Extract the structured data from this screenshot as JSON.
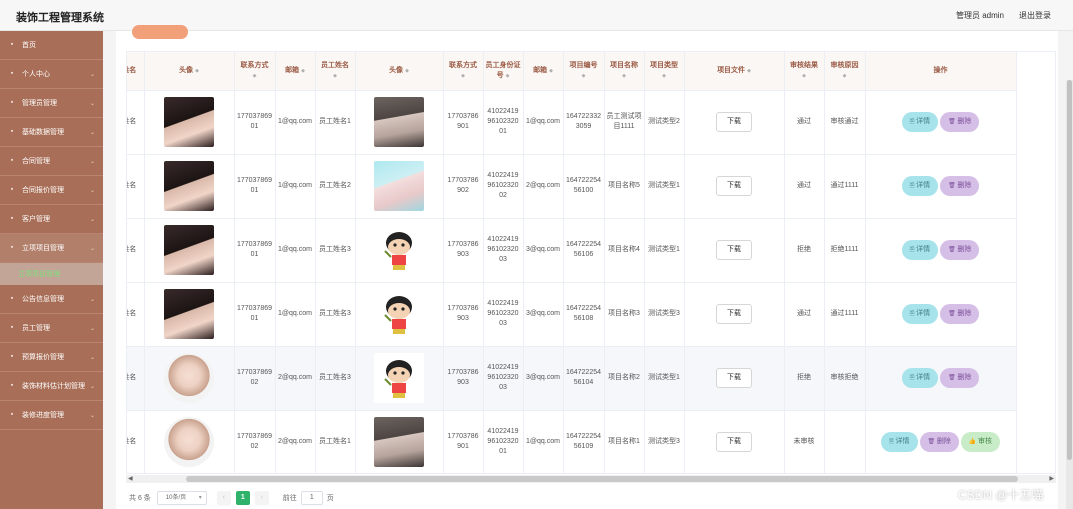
{
  "header": {
    "title": "装饰工程管理系统",
    "user": "管理员 admin",
    "logout": "退出登录"
  },
  "sidebar": {
    "items": [
      {
        "label": "首页",
        "icon": "home-icon"
      },
      {
        "label": "个人中心",
        "icon": "user-icon"
      },
      {
        "label": "管理员管理",
        "icon": "admin-icon"
      },
      {
        "label": "基础数据管理",
        "icon": "data-icon"
      },
      {
        "label": "合同管理",
        "icon": "contract-icon"
      },
      {
        "label": "合同报价管理",
        "icon": "quote-icon"
      },
      {
        "label": "客户管理",
        "icon": "customer-icon"
      },
      {
        "label": "立项项目管理",
        "icon": "project-icon"
      },
      {
        "label": "立项项目管理",
        "icon": "",
        "sub": true
      },
      {
        "label": "公告信息管理",
        "icon": "notice-icon"
      },
      {
        "label": "员工管理",
        "icon": "staff-icon"
      },
      {
        "label": "预算报价管理",
        "icon": "budget-icon"
      },
      {
        "label": "装饰材料估计划管理",
        "icon": "material-icon"
      },
      {
        "label": "装修进度管理",
        "icon": "progress-icon"
      }
    ]
  },
  "table": {
    "headers": {
      "name1": "姓名",
      "avatar1": "头像",
      "phone1": "联系方式",
      "email1": "邮箱",
      "emp_name": "员工姓名",
      "avatar2": "头像",
      "phone2": "联系方式",
      "id_no": "员工身份证号",
      "email2": "邮箱",
      "proj_no": "项目编号",
      "proj_name": "项目名称",
      "proj_type": "项目类型",
      "proj_file": "项目文件",
      "audit_result": "审核结果",
      "audit_reason": "审核原因",
      "ops": "操作"
    },
    "rows": [
      {
        "name1": "姓名",
        "avatar1": "dark-hair-photo",
        "phone1": "17703786901",
        "email1": "1@qq.com",
        "emp_name": "员工姓名1",
        "avatar2": "gray-photo",
        "phone2": "17703786901",
        "id_no": "410224199610232001",
        "email2": "1@qq.com",
        "proj_no": "1647223323059",
        "proj_name": "员工测试项目1111",
        "proj_type": "测试类型2",
        "file_btn": "下载",
        "audit_result": "通过",
        "audit_reason": "审核通过",
        "ops": [
          "详情",
          "删除"
        ]
      },
      {
        "name1": "姓名",
        "avatar1": "dark-hair-photo",
        "phone1": "17703786901",
        "email1": "1@qq.com",
        "emp_name": "员工姓名2",
        "avatar2": "cyan-photo",
        "phone2": "17703786902",
        "id_no": "410224199610232002",
        "email2": "2@qq.com",
        "proj_no": "16472225456100",
        "proj_name": "项目名称5",
        "proj_type": "测试类型1",
        "file_btn": "下载",
        "audit_result": "通过",
        "audit_reason": "通过1111",
        "ops": [
          "详情",
          "删除"
        ]
      },
      {
        "name1": "姓名",
        "avatar1": "dark-hair-photo",
        "phone1": "17703786901",
        "email1": "1@qq.com",
        "emp_name": "员工姓名3",
        "avatar2": "cartoon",
        "phone2": "17703786903",
        "id_no": "410224199610232003",
        "email2": "3@qq.com",
        "proj_no": "16472225456106",
        "proj_name": "项目名称4",
        "proj_type": "测试类型1",
        "file_btn": "下载",
        "audit_result": "拒绝",
        "audit_reason": "拒绝1111",
        "ops": [
          "详情",
          "删除"
        ]
      },
      {
        "name1": "姓名",
        "avatar1": "dark-hair-photo",
        "phone1": "17703786901",
        "email1": "1@qq.com",
        "emp_name": "员工姓名3",
        "avatar2": "cartoon",
        "phone2": "17703786903",
        "id_no": "410224199610232003",
        "email2": "3@qq.com",
        "proj_no": "16472225456108",
        "proj_name": "项目名称3",
        "proj_type": "测试类型3",
        "file_btn": "下载",
        "audit_result": "通过",
        "audit_reason": "通过1111",
        "ops": [
          "详情",
          "删除"
        ]
      },
      {
        "name1": "姓名",
        "avatar1": "light-photo",
        "phone1": "17703786902",
        "email1": "2@qq.com",
        "emp_name": "员工姓名3",
        "avatar2": "cartoon",
        "phone2": "17703786903",
        "id_no": "410224199610232003",
        "email2": "3@qq.com",
        "proj_no": "16472225456104",
        "proj_name": "项目名称2",
        "proj_type": "测试类型1",
        "file_btn": "下载",
        "audit_result": "拒绝",
        "audit_reason": "审核拒绝",
        "ops": [
          "详情",
          "删除"
        ]
      },
      {
        "name1": "姓名",
        "avatar1": "light-photo",
        "phone1": "17703786902",
        "email1": "2@qq.com",
        "emp_name": "员工姓名1",
        "avatar2": "gray-photo",
        "phone2": "17703786901",
        "id_no": "410224199610232001",
        "email2": "1@qq.com",
        "proj_no": "16472225456109",
        "proj_name": "项目名称1",
        "proj_type": "测试类型3",
        "file_btn": "下载",
        "audit_result": "未审核",
        "audit_reason": "",
        "ops": [
          "详情",
          "删除",
          "审核"
        ]
      }
    ]
  },
  "pagination": {
    "total": "共 6 条",
    "page_size": "10条/页",
    "current": "1",
    "goto_label": "前往",
    "goto_value": "1",
    "page_suffix": "页"
  },
  "watermark": "CSDN @十五喵"
}
